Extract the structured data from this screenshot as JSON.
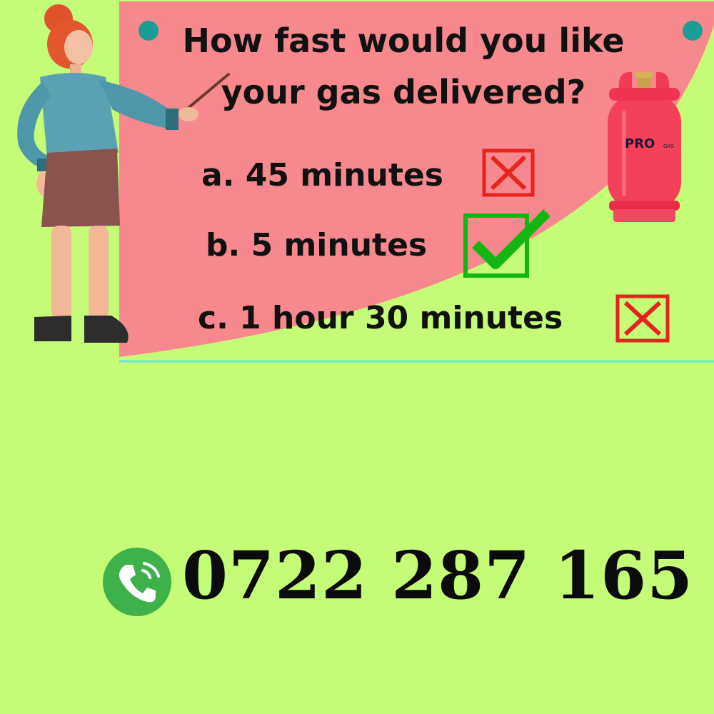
{
  "question": {
    "line1": "How fast would you like",
    "line2": "your gas delivered?"
  },
  "options": [
    {
      "label": "a. 45 minutes",
      "mark": "cross-icon"
    },
    {
      "label": "b. 5 minutes",
      "mark": "check-icon"
    },
    {
      "label": "c. 1 hour 30 minutes",
      "mark": "cross-icon"
    }
  ],
  "cylinder": {
    "brand": "PRO",
    "brand_suffix": "GAS"
  },
  "contact": {
    "phone": "0722 287 165",
    "icon": "phone-icon"
  },
  "colors": {
    "background": "#c4fb77",
    "board": "#f7888e",
    "cross": "#e5241b",
    "check": "#14b614",
    "pin": "#1a9e94",
    "phone_circle": "#3fb14b"
  }
}
